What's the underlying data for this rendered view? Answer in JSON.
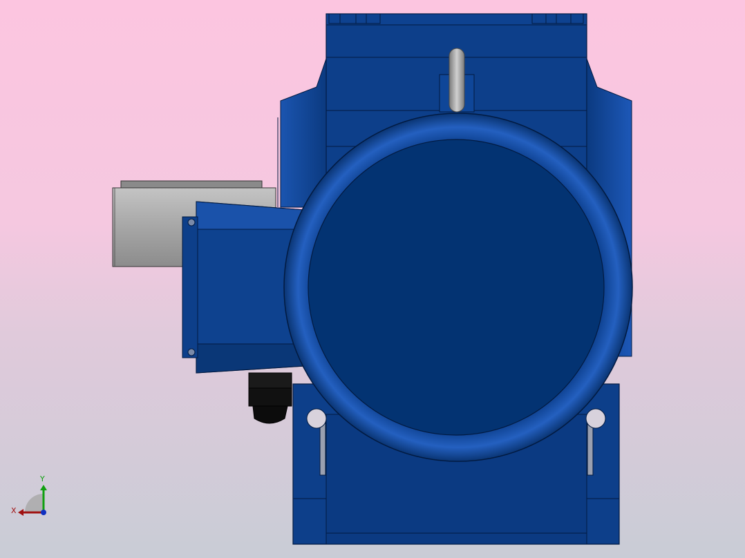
{
  "viewport": {
    "background_top": "#fcc5e0",
    "background_bottom": "#c9ccd6"
  },
  "model": {
    "body_color": "#0d3f8a",
    "body_dark": "#05306a",
    "terminal_box_color": "#9a9a9a",
    "lifting_eye_color": "#a8a8a8",
    "cable_gland_color": "#1a1a1a"
  },
  "triad": {
    "x_label": "X",
    "y_label": "Y",
    "x_color": "#a01010",
    "y_color": "#10a010",
    "z_color": "#1030c0"
  }
}
